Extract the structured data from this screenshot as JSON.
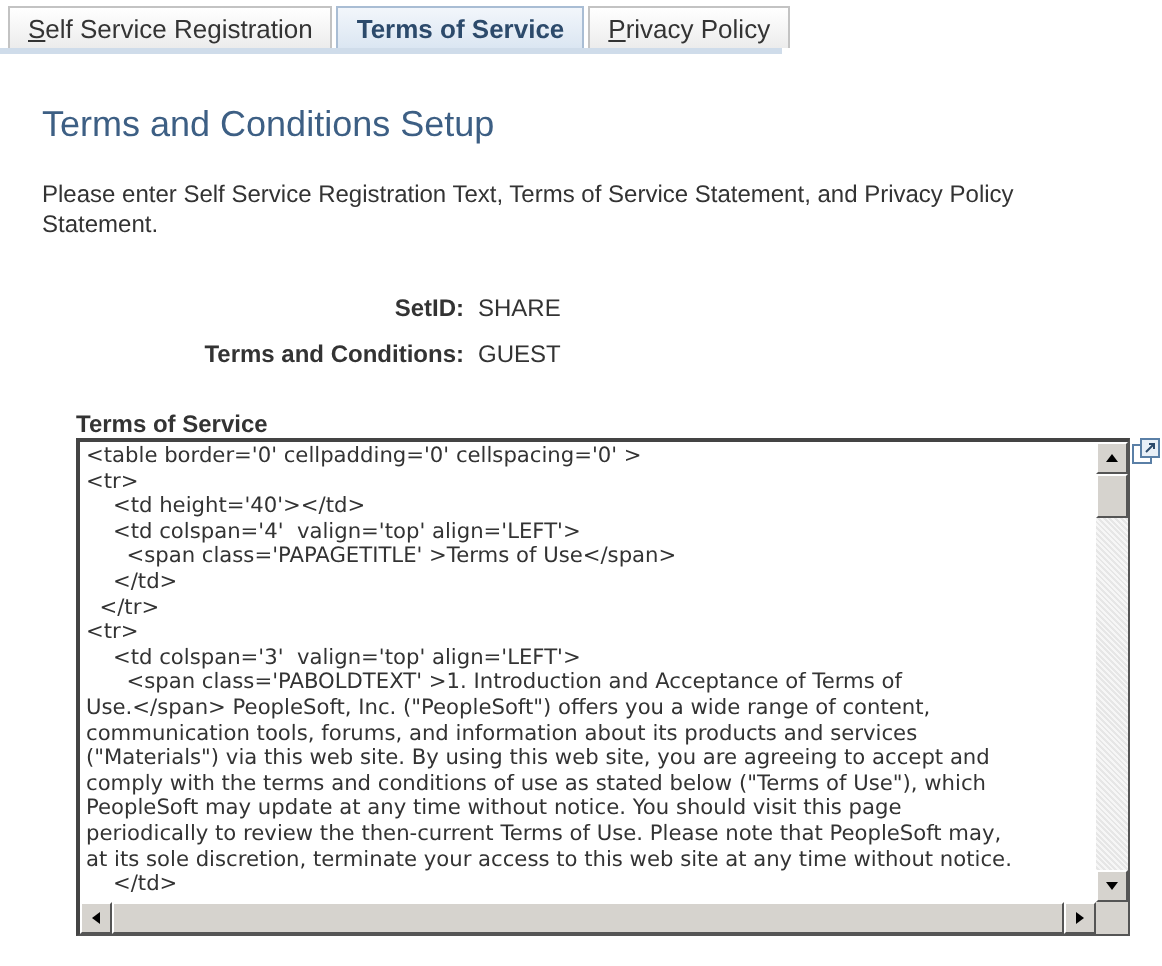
{
  "tabs": [
    {
      "label": "Self Service Registration",
      "selected": false,
      "access_key_underlined": true
    },
    {
      "label": "Terms of Service",
      "selected": true,
      "access_key_underlined": false
    },
    {
      "label": "Privacy Policy",
      "selected": false,
      "access_key_underlined": true
    }
  ],
  "page_title": "Terms and Conditions Setup",
  "instructions": "Please enter Self Service Registration Text, Terms of Service Statement, and Privacy Policy Statement.",
  "fields": [
    {
      "label": "SetID:",
      "value": "SHARE"
    },
    {
      "label": "Terms and Conditions:",
      "value": "GUEST"
    }
  ],
  "editor": {
    "label": "Terms of Service",
    "lines": [
      "<table border='0' cellpadding='0' cellspacing='0' >",
      "<tr>",
      "    <td height='40'></td>",
      "    <td colspan='4'  valign='top' align='LEFT'>",
      "      <span class='PAPAGETITLE' >Terms of Use</span>",
      "    </td>",
      "  </tr>",
      "<tr>",
      "    <td colspan='3'  valign='top' align='LEFT'>",
      "      <span class='PABOLDTEXT' >1. Introduction and Acceptance of Terms of",
      "Use.</span> PeopleSoft, Inc. (\"PeopleSoft\") offers you a wide range of content,",
      "communication tools, forums, and information about its products and services",
      "(\"Materials\") via this web site. By using this web site, you are agreeing to accept and",
      "comply with the terms and conditions of use as stated below (\"Terms of Use\"), which",
      "PeopleSoft may update at any time without notice. You should visit this page",
      "periodically to review the then-current Terms of Use. Please note that PeopleSoft may,",
      "at its sole discretion, terminate your access to this web site at any time without notice.",
      "    </td>"
    ]
  }
}
